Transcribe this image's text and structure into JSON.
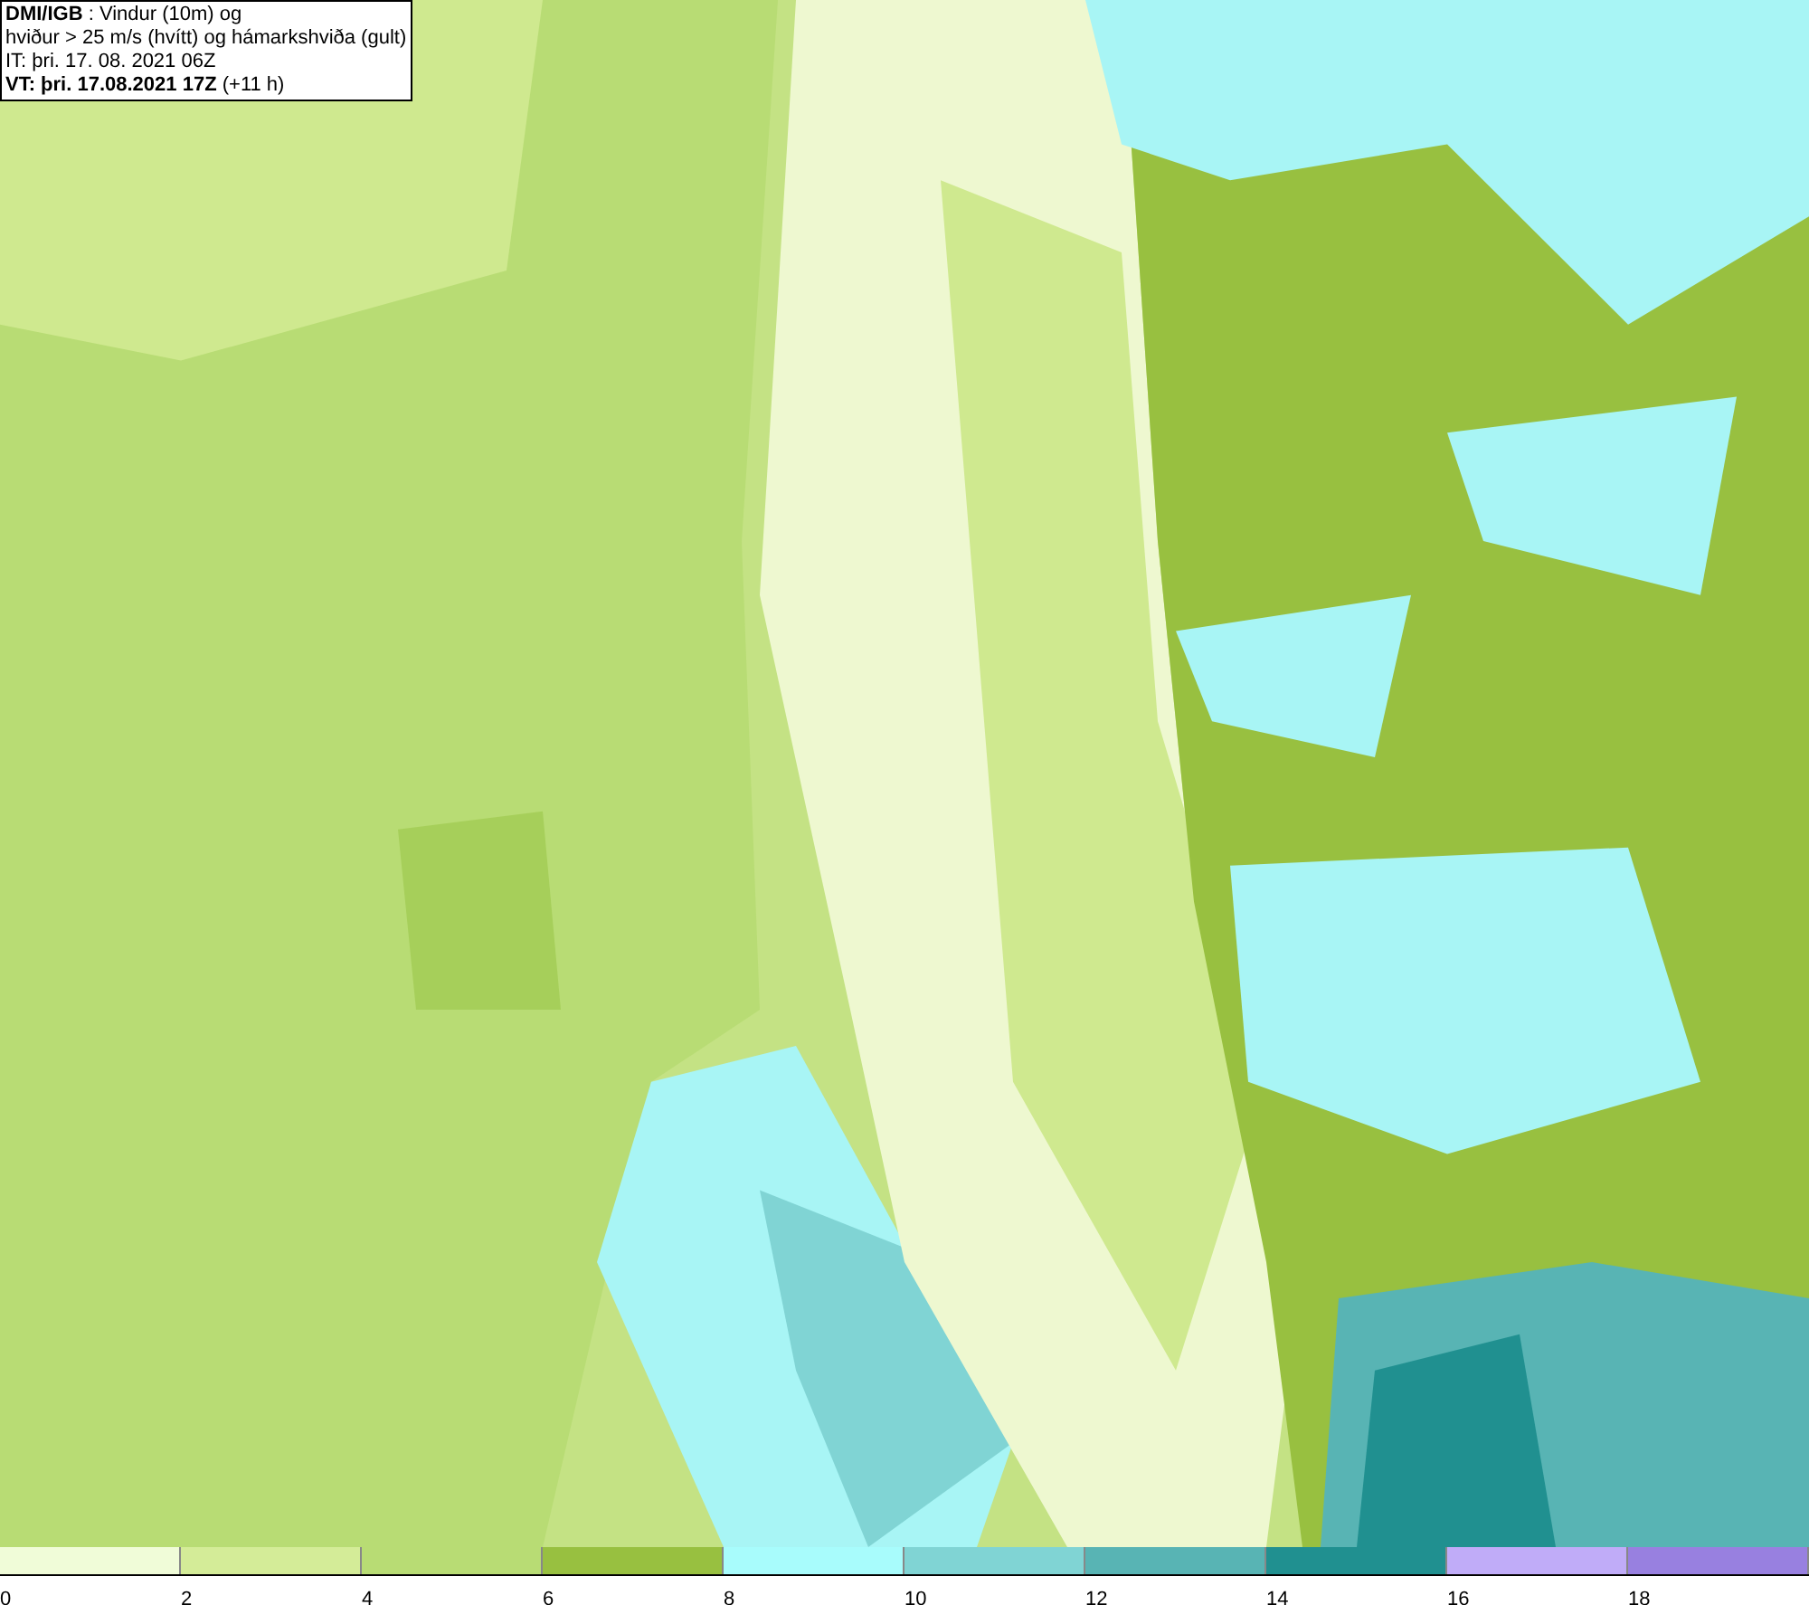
{
  "header": {
    "lines": [
      "**DMI/IGB** : Vindur (10m) og",
      "hviður > 25 m/s (hvítt) og hámarkshviða (gult)",
      "IT: þri. 17. 08. 2021 06Z",
      "**VT: þri. 17.08.2021 17Z** (+11 h)"
    ]
  },
  "legend": [
    {
      "label": "0",
      "color": "#f0fcd8"
    },
    {
      "label": "2",
      "color": "#d4ec98"
    },
    {
      "label": "4",
      "color": "#b8dc74"
    },
    {
      "label": "6",
      "color": "#98c040"
    },
    {
      "label": "8",
      "color": "#a8fcfc"
    },
    {
      "label": "10",
      "color": "#80d4d4"
    },
    {
      "label": "12",
      "color": "#58b4b4"
    },
    {
      "label": "14",
      "color": "#209090"
    },
    {
      "label": "16",
      "color": "#c0acf8"
    },
    {
      "label": "18",
      "color": "#9880e0"
    }
  ]
}
